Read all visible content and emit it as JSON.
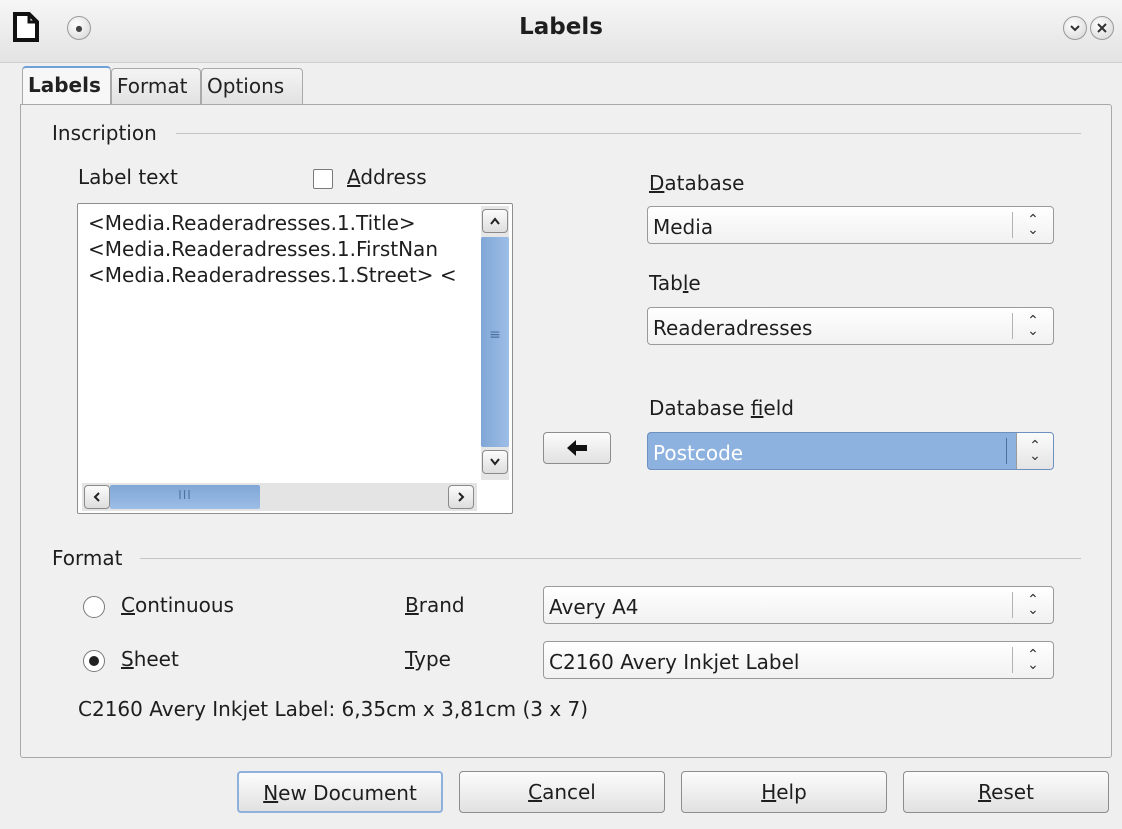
{
  "window": {
    "title": "Labels"
  },
  "tabs": [
    {
      "label": "Labels",
      "active": true
    },
    {
      "label": "Format",
      "active": false
    },
    {
      "label": "Options",
      "active": false
    }
  ],
  "inscription": {
    "group_label": "Inscription",
    "label_text_caption": "Label text",
    "address_checkbox": {
      "label": "Address",
      "checked": false
    },
    "label_lines": [
      "<Media.Readeradresses.1.Title>",
      "<Media.Readeradresses.1.FirstNan",
      "<Media.Readeradresses.1.Street> <"
    ],
    "hscroll_thumb_glyph": "III",
    "vscroll_thumb_glyph": "≡",
    "database": {
      "label": "Database",
      "value": "Media"
    },
    "table": {
      "label": "Table",
      "value": "Readeradresses"
    },
    "database_field": {
      "label": "Database field",
      "value": "Postcode"
    }
  },
  "format": {
    "group_label": "Format",
    "continuous": {
      "label": "Continuous",
      "checked": false
    },
    "sheet": {
      "label": "Sheet",
      "checked": true
    },
    "brand": {
      "label": "Brand",
      "value": "Avery A4"
    },
    "type": {
      "label": "Type",
      "value": "C2160 Avery Inkjet Label"
    },
    "description": "C2160 Avery Inkjet Label: 6,35cm x 3,81cm (3 x 7)"
  },
  "buttons": {
    "new_document": "New Document",
    "cancel": "Cancel",
    "help": "Help",
    "reset": "Reset"
  },
  "colors": {
    "selection": "#8eb2df",
    "scroll_thumb": "#8fb0da"
  }
}
